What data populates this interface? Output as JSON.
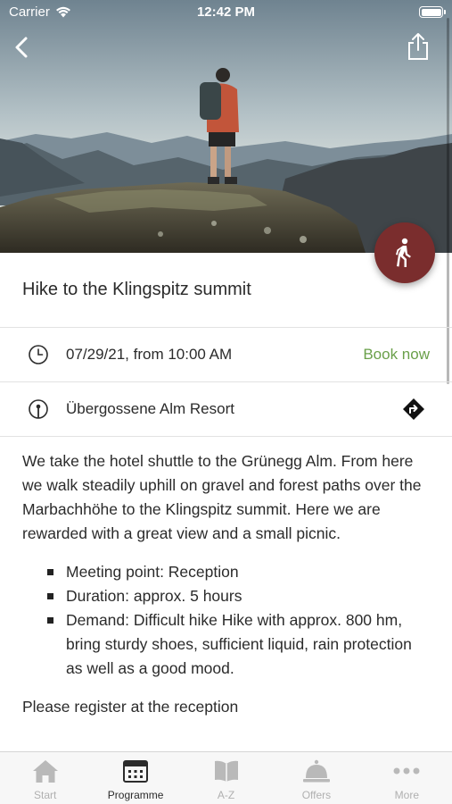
{
  "status_bar": {
    "carrier": "Carrier",
    "time": "12:42 PM"
  },
  "nav": {
    "back_icon": "chevron-left-icon",
    "share_icon": "share-icon"
  },
  "fab": {
    "icon": "hiker-icon",
    "color": "#7a2d2d"
  },
  "event": {
    "title": "Hike to the Klingspitz summit",
    "date_time": "07/29/21, from 10:00 AM",
    "book_label": "Book now",
    "location": "Übergossene Alm Resort",
    "description": "We take the hotel shuttle to the Grünegg Alm. From here we walk steadily uphill on gravel and forest paths over the Marbachhöhe to the Klingspitz summit. Here we are rewarded with a great view and a small picnic.",
    "bullets": [
      "Meeting point: Reception",
      "Duration: approx. 5 hours",
      "Demand: Difficult hike Hike with approx. 800 hm, bring sturdy shoes, sufficient liquid, rain protection as well as a good mood."
    ],
    "footer_note": "Please register at the reception"
  },
  "tabs": [
    {
      "label": "Start",
      "icon": "house-icon",
      "active": false
    },
    {
      "label": "Programme",
      "icon": "calendar-icon",
      "active": true
    },
    {
      "label": "A-Z",
      "icon": "book-icon",
      "active": false
    },
    {
      "label": "Offers",
      "icon": "bell-icon",
      "active": false
    },
    {
      "label": "More",
      "icon": "more-dots-icon",
      "active": false
    }
  ],
  "colors": {
    "accent_green": "#6aa04a",
    "fab_red": "#7a2d2d",
    "text": "#2b2b2b"
  }
}
